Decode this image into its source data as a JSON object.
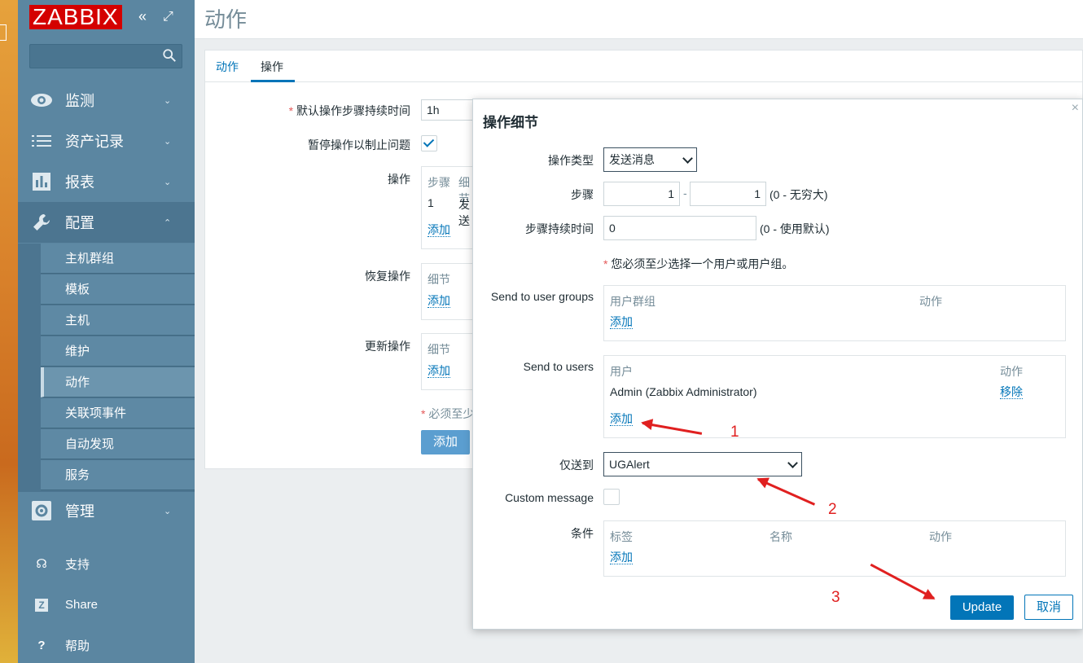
{
  "sidebar": {
    "logo": "ZABBIX",
    "collapse_icon": "«",
    "expand_icon": "⤢",
    "search": {
      "value": "",
      "placeholder": ""
    },
    "menu": [
      {
        "label": "监测",
        "icon": "eye-icon"
      },
      {
        "label": "资产记录",
        "icon": "list-icon"
      },
      {
        "label": "报表",
        "icon": "bar-chart-icon"
      },
      {
        "label": "配置",
        "icon": "wrench-icon"
      },
      {
        "label": "管理",
        "icon": "gear-icon"
      }
    ],
    "submenu": [
      "主机群组",
      "模板",
      "主机",
      "维护",
      "动作",
      "关联项事件",
      "自动发现",
      "服务"
    ],
    "bottom": [
      {
        "label": "支持",
        "icon": "headset-icon",
        "glyph": "☊"
      },
      {
        "label": "Share",
        "icon": "share-icon",
        "glyph": "Z"
      },
      {
        "label": "帮助",
        "icon": "help-icon",
        "glyph": "?"
      }
    ]
  },
  "page": {
    "title": "动作"
  },
  "tabs": [
    "动作",
    "操作"
  ],
  "form": {
    "default_duration_label": "默认操作步骤持续时间",
    "default_duration_value": "1h",
    "pause_label": "暂停操作以制止问题",
    "pause_checked": true,
    "operations_label": "操作",
    "operations_header": [
      "步骤",
      "细节"
    ],
    "operations_row": [
      "1",
      "发送"
    ],
    "operations_add": "添加",
    "recovery_label": "恢复操作",
    "recovery_header": "细节",
    "recovery_add": "添加",
    "update_label": "更新操作",
    "update_header": "细节",
    "update_add": "添加",
    "required_note": "必须至少",
    "add_button": "添加"
  },
  "dialog": {
    "title": "操作细节",
    "close_icon": "×",
    "operation_type_label": "操作类型",
    "operation_type_value": "发送消息",
    "steps_label": "步骤",
    "step_from": "1",
    "step_sep": "-",
    "step_to": "1",
    "steps_hint": "(0 - 无穷大)",
    "step_duration_label": "步骤持续时间",
    "step_duration_value": "0",
    "step_duration_hint": "(0 - 使用默认)",
    "user_required_note": "您必须至少选择一个用户或用户组。",
    "send_groups_label": "Send to user groups",
    "groups_header": [
      "用户群组",
      "动作"
    ],
    "groups_add": "添加",
    "send_users_label": "Send to users",
    "users_header": [
      "用户",
      "动作"
    ],
    "users_rows": [
      {
        "name": "Admin (Zabbix Administrator)",
        "action": "移除"
      }
    ],
    "users_add": "添加",
    "send_only_label": "仅送到",
    "send_only_value": "UGAlert",
    "custom_message_label": "Custom message",
    "custom_message_checked": false,
    "conditions_label": "条件",
    "conditions_header": [
      "标签",
      "名称",
      "动作"
    ],
    "conditions_add": "添加",
    "update_button": "Update",
    "cancel_button": "取消"
  },
  "annotations": [
    "1",
    "2",
    "3"
  ],
  "colors": {
    "sidebar": "#5b86a1",
    "accent": "#0275b8",
    "logo": "#d40000",
    "annotation": "#e02020"
  }
}
